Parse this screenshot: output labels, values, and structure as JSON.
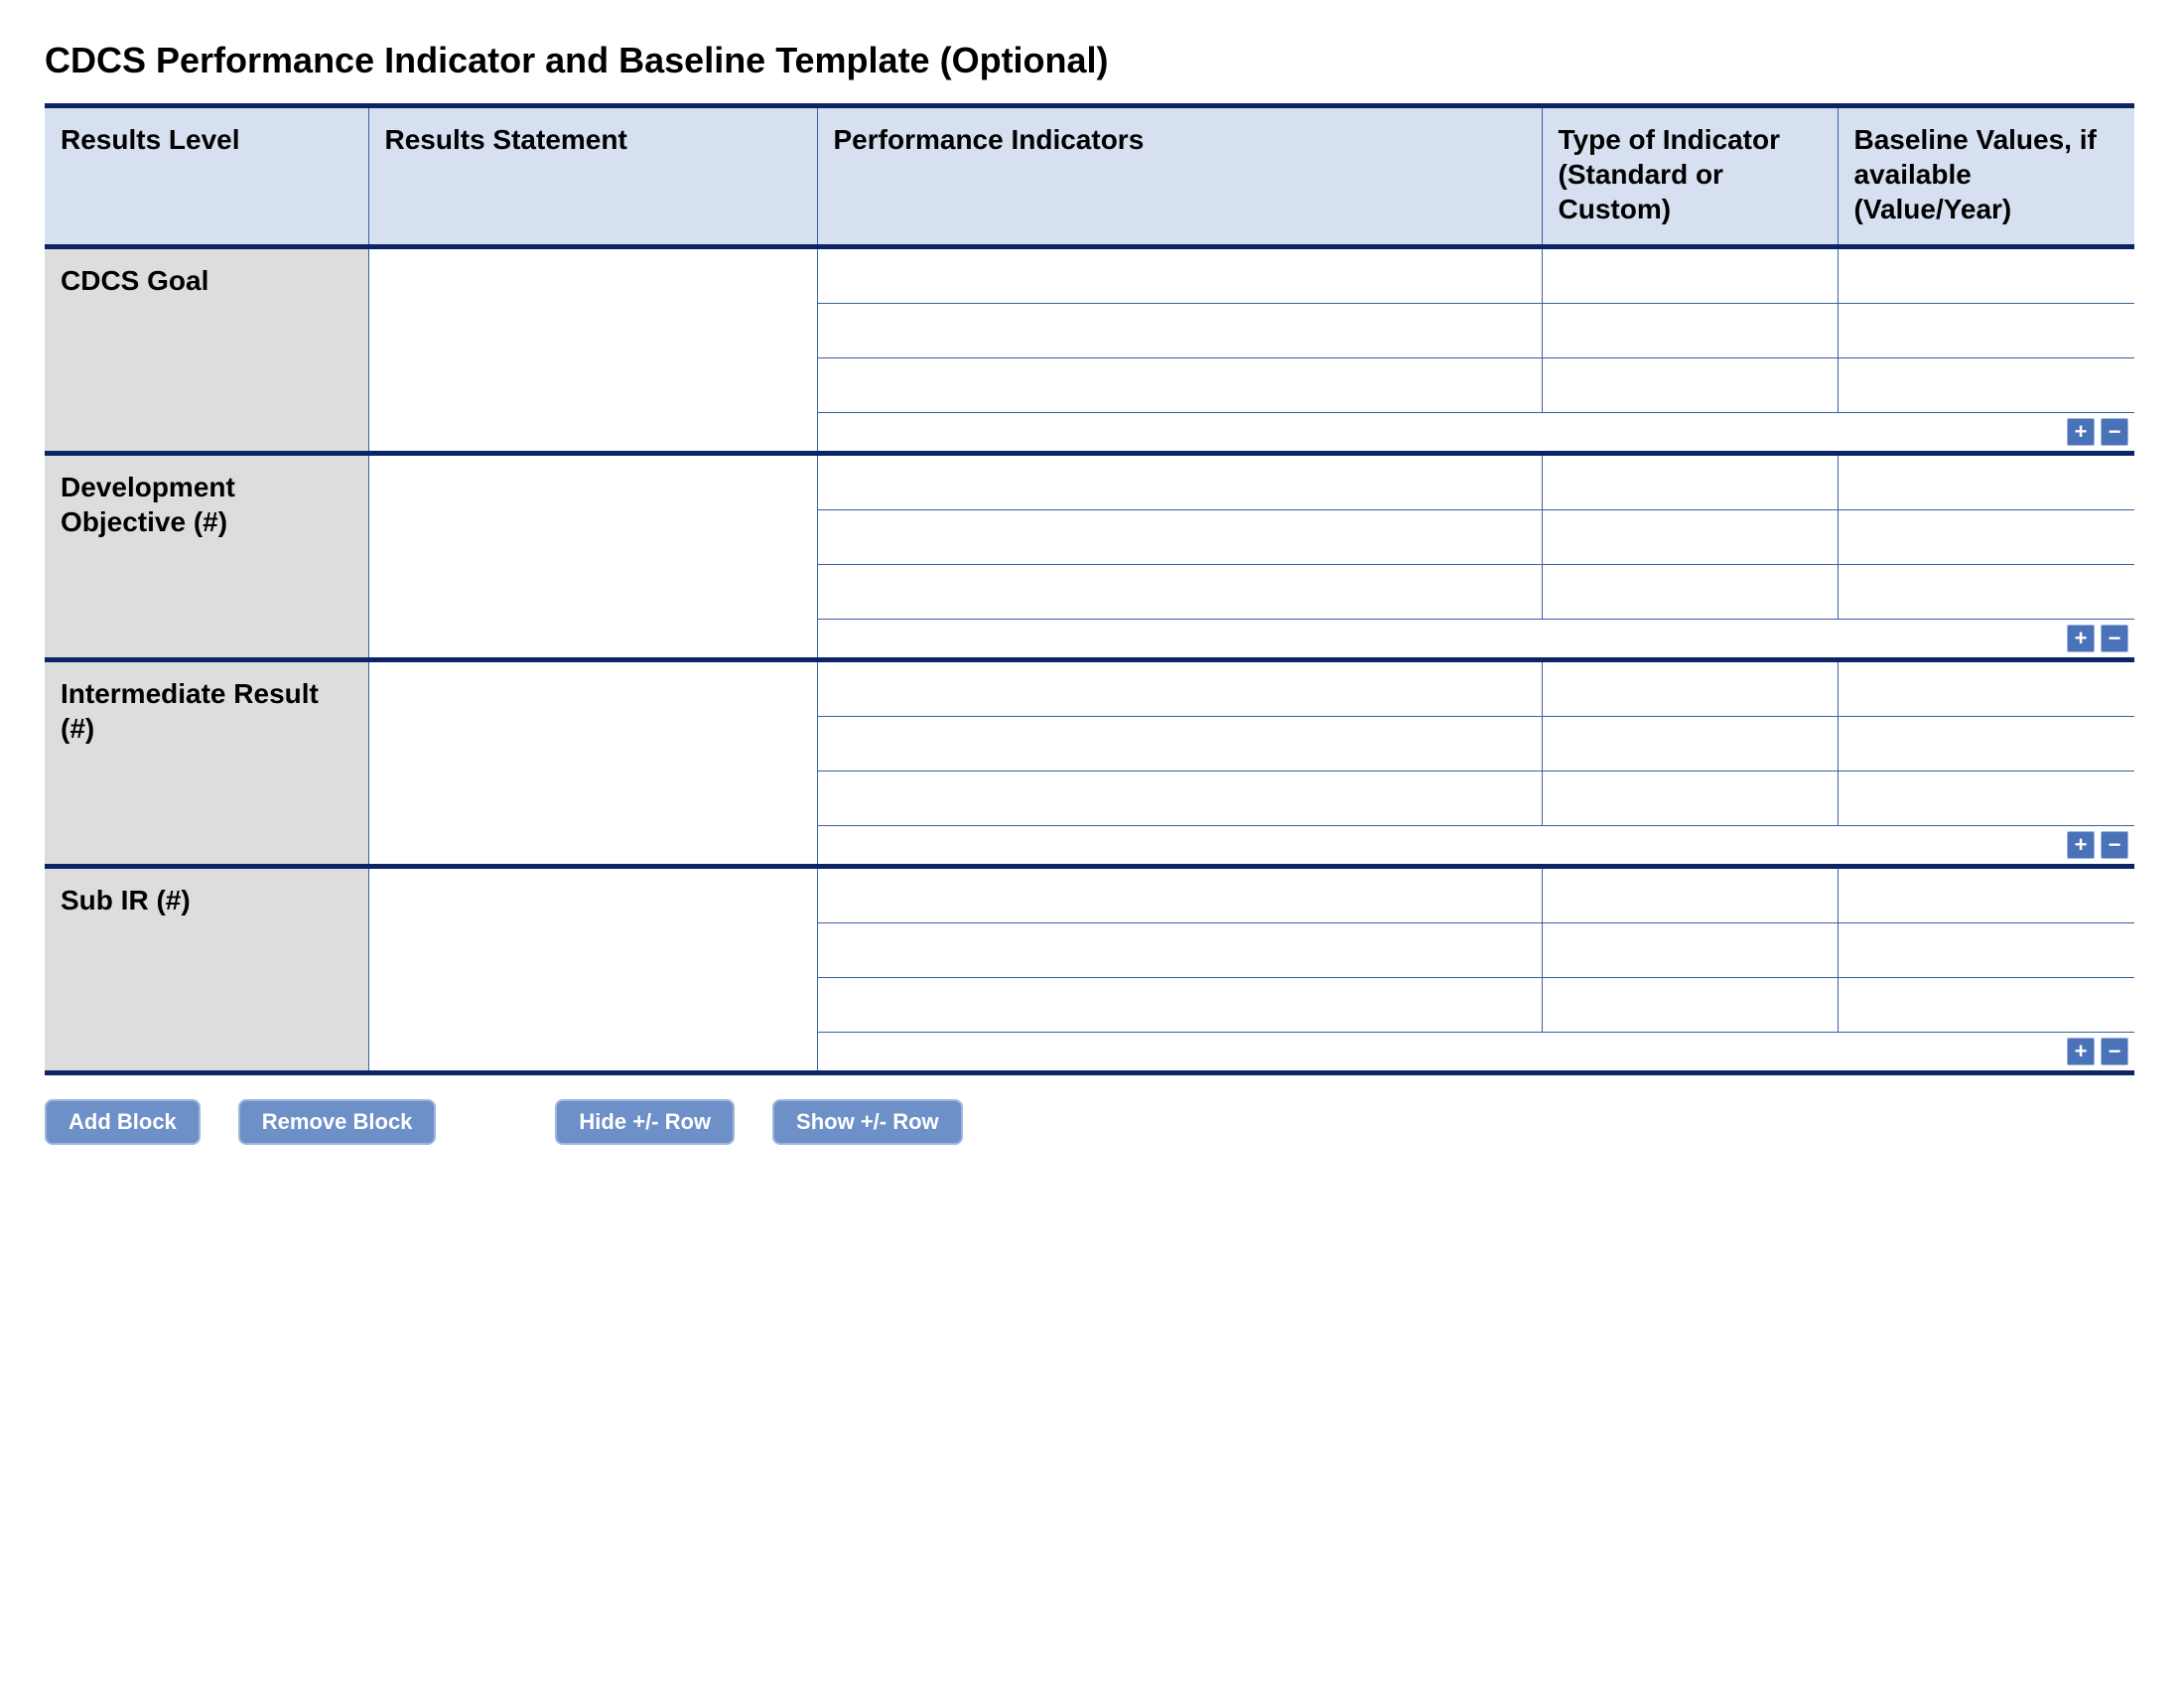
{
  "title": "CDCS Performance Indicator and Baseline Template (Optional)",
  "headers": {
    "results_level": "Results Level",
    "results_statement": "Results Statement",
    "performance_indicators": "Performance Indicators",
    "type_of_indicator": "Type of Indicator (Standard or Custom)",
    "baseline_values": "Baseline Values, if available (Value/Year)"
  },
  "sections": [
    {
      "level_label": "CDCS Goal",
      "statement": "",
      "indicator_rows": [
        {
          "indicator": "",
          "type": "",
          "baseline": ""
        },
        {
          "indicator": "",
          "type": "",
          "baseline": ""
        },
        {
          "indicator": "",
          "type": "",
          "baseline": ""
        }
      ]
    },
    {
      "level_label": "Development Objective (#)",
      "statement": "",
      "indicator_rows": [
        {
          "indicator": "",
          "type": "",
          "baseline": ""
        },
        {
          "indicator": "",
          "type": "",
          "baseline": ""
        },
        {
          "indicator": "",
          "type": "",
          "baseline": ""
        }
      ]
    },
    {
      "level_label": "Intermediate Result (#)",
      "statement": "",
      "indicator_rows": [
        {
          "indicator": "",
          "type": "",
          "baseline": ""
        },
        {
          "indicator": "",
          "type": "",
          "baseline": ""
        },
        {
          "indicator": "",
          "type": "",
          "baseline": ""
        }
      ]
    },
    {
      "level_label": "Sub IR (#)",
      "statement": "",
      "indicator_rows": [
        {
          "indicator": "",
          "type": "",
          "baseline": ""
        },
        {
          "indicator": "",
          "type": "",
          "baseline": ""
        },
        {
          "indicator": "",
          "type": "",
          "baseline": ""
        }
      ]
    }
  ],
  "row_controls": {
    "add_label": "+",
    "remove_label": "−"
  },
  "buttons": {
    "add_block": "Add Block",
    "remove_block": "Remove Block",
    "hide_row": "Hide +/- Row",
    "show_row": "Show +/- Row"
  }
}
